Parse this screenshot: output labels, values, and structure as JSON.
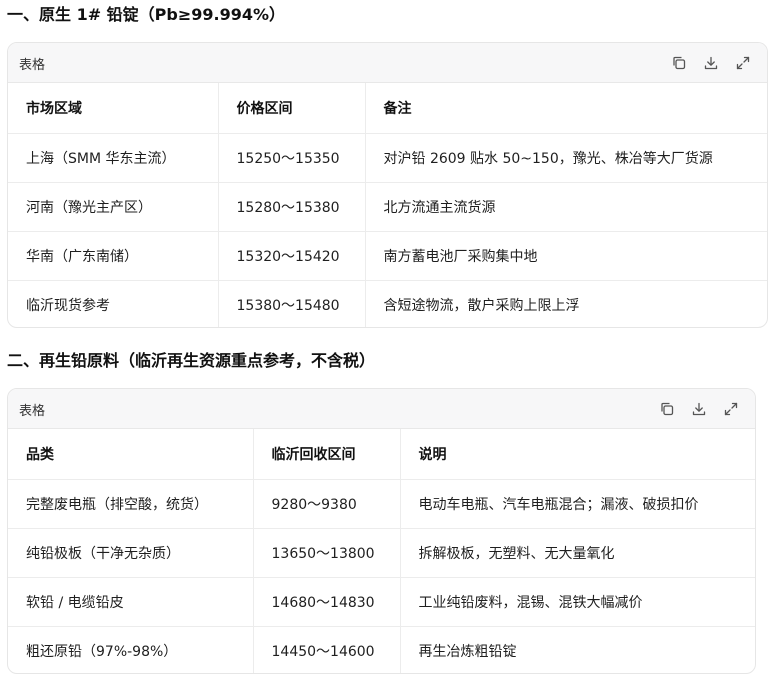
{
  "section1": {
    "title": "一、原生 1# 铅锭（Pb≥99.994%）",
    "table_label": "表格",
    "headers": [
      "市场区域",
      "价格区间",
      "备注"
    ],
    "rows": [
      [
        "上海（SMM 华东主流）",
        "15250～15350",
        "对沪铅 2609 贴水 50~150，豫光、株冶等大厂货源"
      ],
      [
        "河南（豫光主产区）",
        "15280～15380",
        "北方流通主流货源"
      ],
      [
        "华南（广东南储）",
        "15320～15420",
        "南方蓄电池厂采购集中地"
      ],
      [
        "临沂现货参考",
        "15380～15480",
        "含短途物流，散户采购上限上浮"
      ]
    ]
  },
  "section2": {
    "title": "二、再生铅原料（临沂再生资源重点参考，不含税）",
    "table_label": "表格",
    "headers": [
      "品类",
      "临沂回收区间",
      "说明"
    ],
    "rows": [
      [
        "完整废电瓶（排空酸，统货）",
        "9280～9380",
        "电动车电瓶、汽车电瓶混合；漏液、破损扣价"
      ],
      [
        "纯铅极板（干净无杂质）",
        "13650～13800",
        "拆解极板，无塑料、无大量氧化"
      ],
      [
        "软铅 / 电缆铅皮",
        "14680～14830",
        "工业纯铅废料，混锡、混铁大幅减价"
      ],
      [
        "粗还原铅（97%-98%）",
        "14450～14600",
        "再生冶炼粗铅锭"
      ]
    ]
  },
  "icons": {
    "copy": "copy-icon",
    "download": "download-icon",
    "expand": "expand-icon"
  }
}
